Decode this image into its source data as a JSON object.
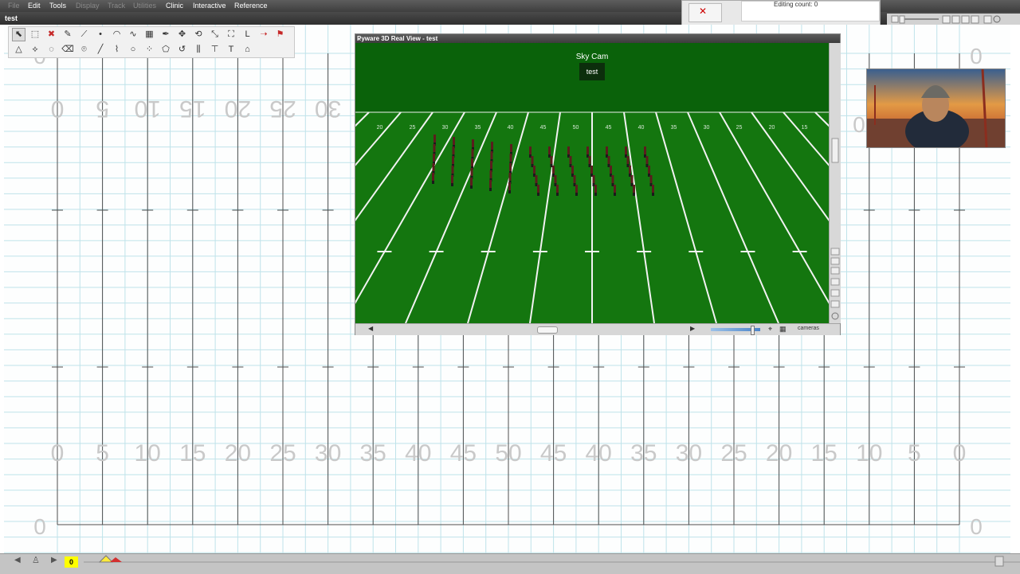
{
  "menubar": {
    "items": [
      {
        "label": "File",
        "enabled": false
      },
      {
        "label": "Edit",
        "enabled": true
      },
      {
        "label": "Tools",
        "enabled": true
      },
      {
        "label": "Display",
        "enabled": false
      },
      {
        "label": "Track",
        "enabled": false
      },
      {
        "label": "Utilities",
        "enabled": false
      },
      {
        "label": "Clinic",
        "enabled": true
      },
      {
        "label": "Interactive",
        "enabled": true
      },
      {
        "label": "Reference",
        "enabled": true
      }
    ]
  },
  "document": {
    "title": "test"
  },
  "status": {
    "editing_count": "Editing count: 0"
  },
  "field": {
    "main_yard_labels": [
      "0",
      "5",
      "10",
      "15",
      "20",
      "25",
      "30",
      "35",
      "40",
      "45",
      "50",
      "45",
      "40",
      "35",
      "30",
      "25",
      "20",
      "15",
      "10",
      "5",
      "0"
    ],
    "upper_yard_labels": [
      "0",
      "5",
      "10",
      "15",
      "20",
      "25",
      "30"
    ],
    "end_zero_label": "0",
    "colors": {
      "grid": "#bfe3ea",
      "yard_line": "#4f4f4f",
      "numbers": "#c9c9c9"
    }
  },
  "real_view": {
    "title": "Pyware 3D Real View - test",
    "camera_label": "Sky Cam",
    "show_name": "test",
    "camera_menu": "cameras",
    "turf_color": "#14760f",
    "sky_color": "#0a620a"
  },
  "toolbar": {
    "row1": [
      "select-arrow",
      "marquee",
      "delete",
      "pencil",
      "path",
      "dot",
      "arc",
      "curve",
      "grid",
      "pen",
      "move",
      "rotate",
      "scale",
      "expand",
      "letter-L",
      "arrow",
      "flag"
    ],
    "row2": [
      "triangle",
      "lasso",
      "lasso-circle",
      "eraser",
      "pin",
      "line",
      "zigzag",
      "circle",
      "dots",
      "polygon",
      "undo",
      "columns",
      "spread",
      "text",
      "home"
    ]
  },
  "timeline": {
    "current_count": "0"
  }
}
